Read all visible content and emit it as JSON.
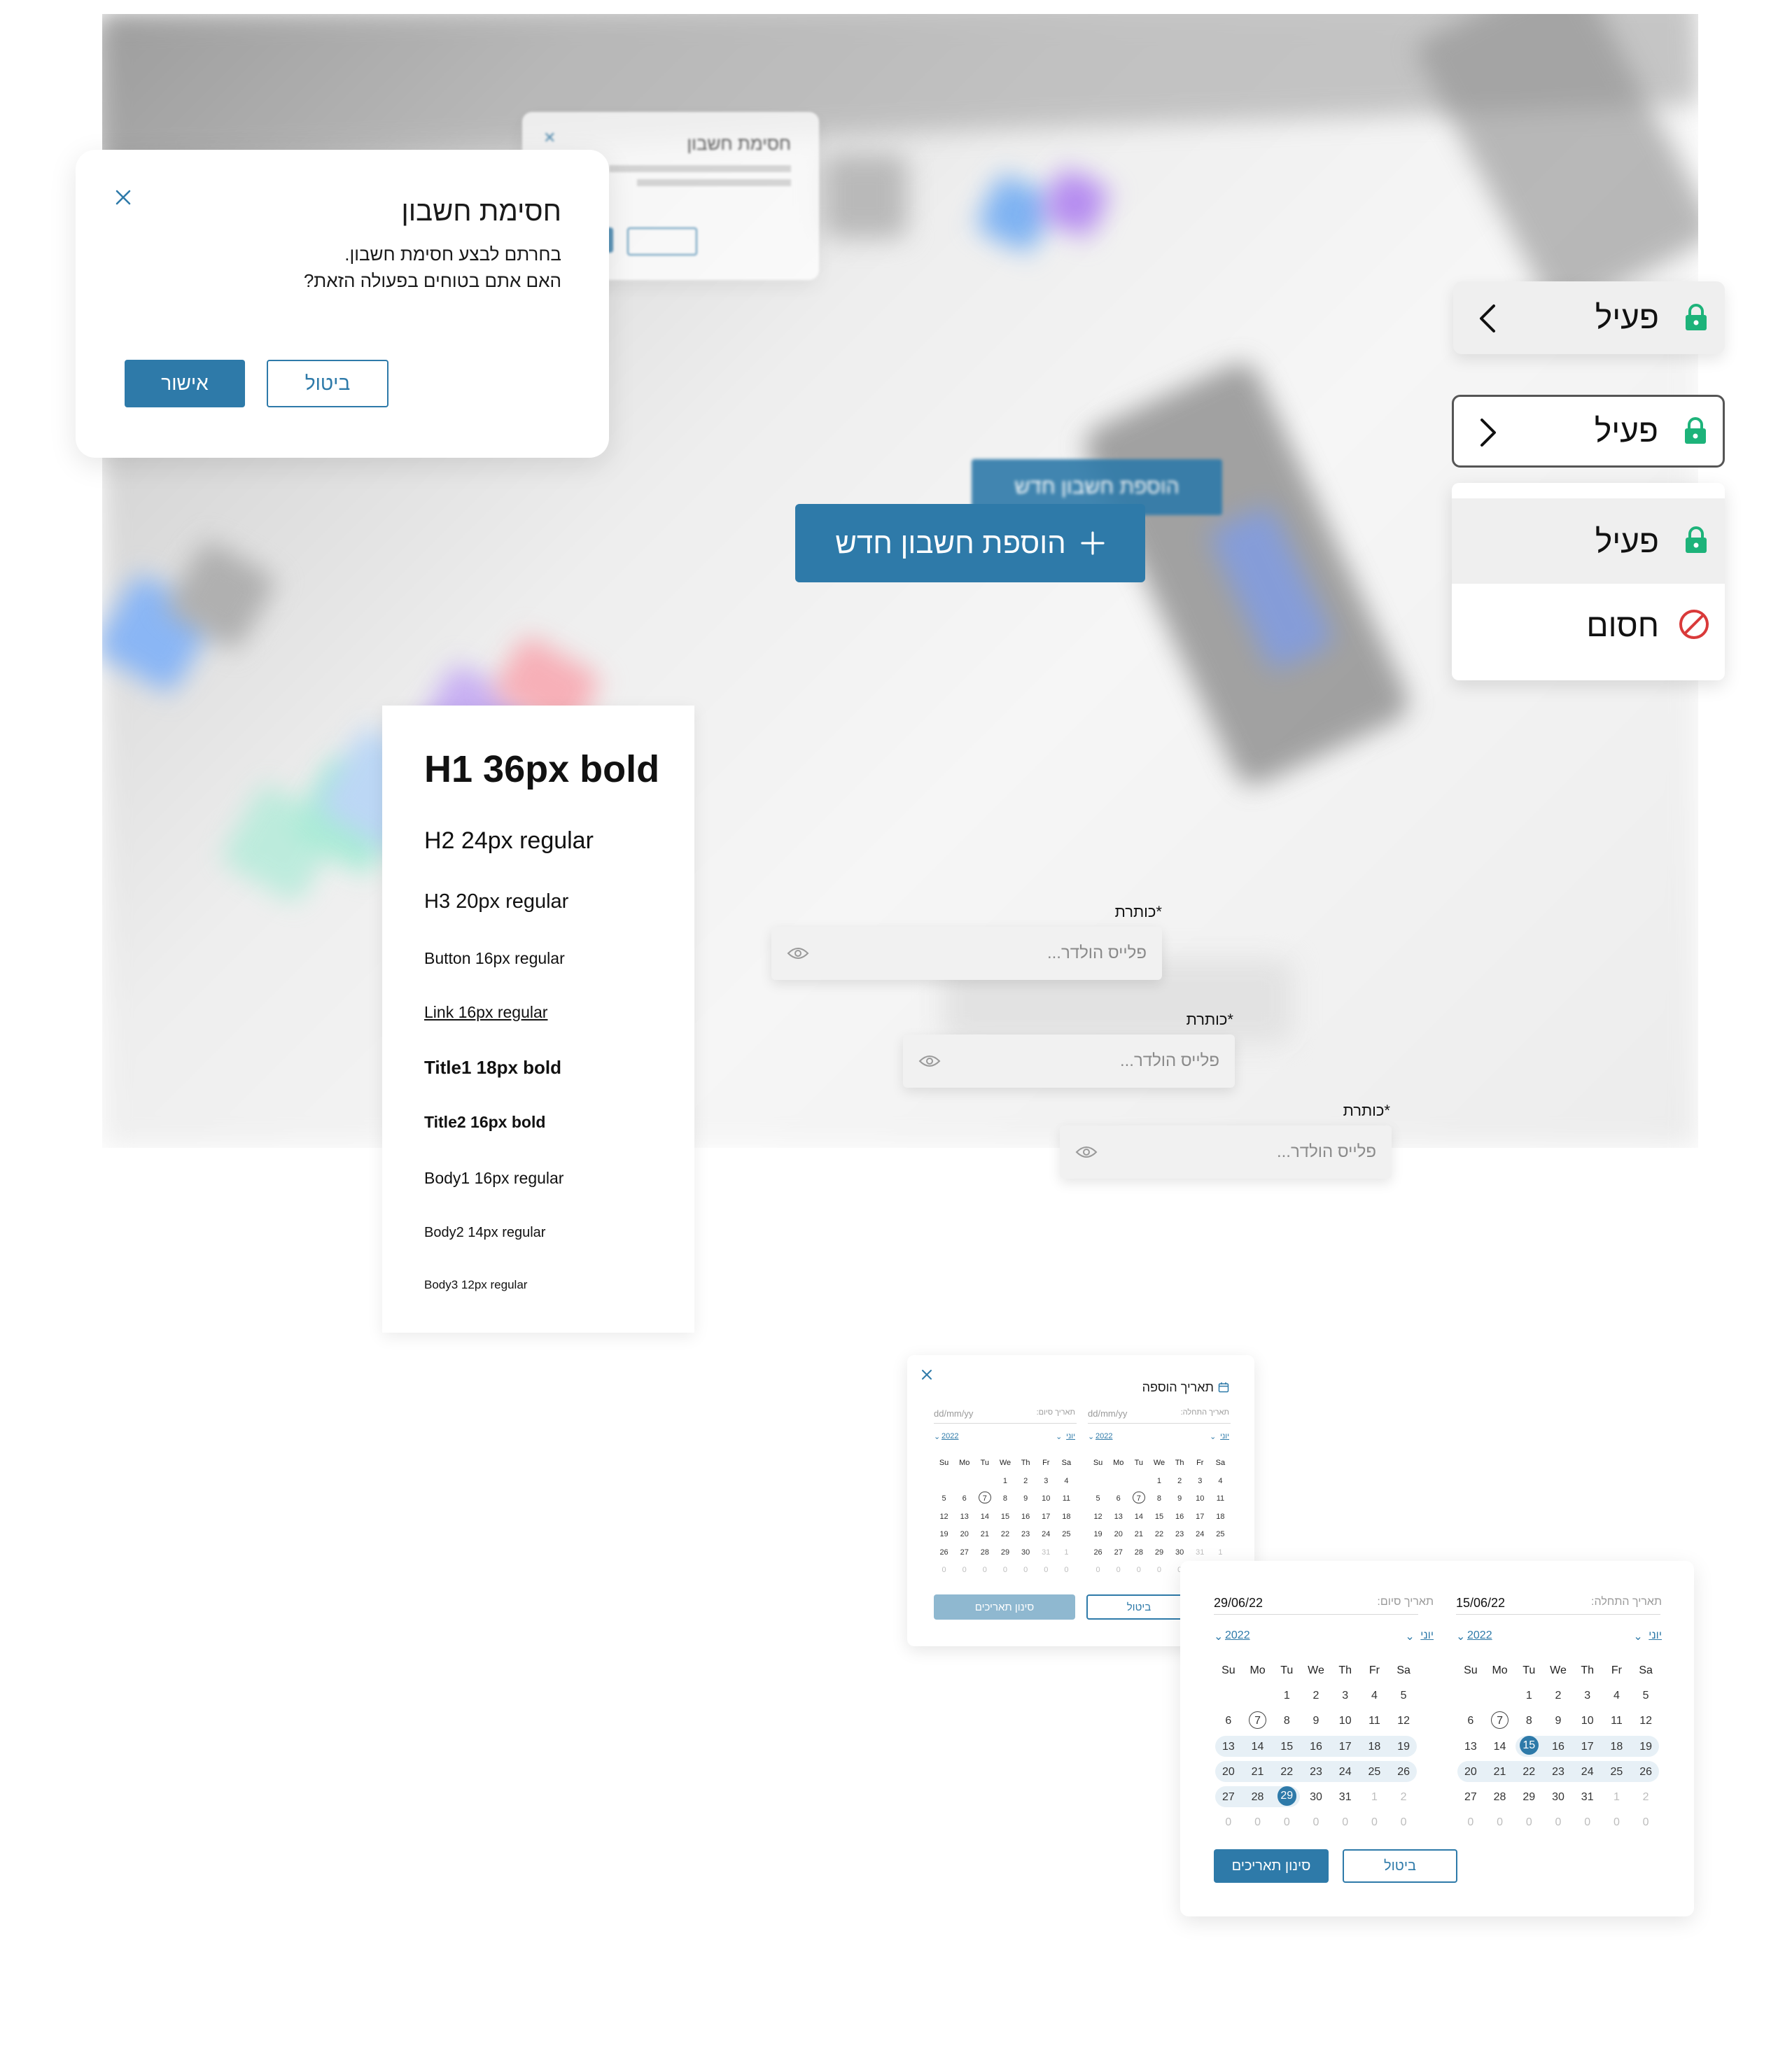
{
  "modal": {
    "title": "חסימת חשבון",
    "line1": "בחרתם לבצע חסימת חשבון.",
    "line2": "האם אתם בטוחים בפעולה הזאת?",
    "confirm": "אישור",
    "cancel": "ביטול"
  },
  "add_account_button": {
    "label": "הוספת חשבון חדש"
  },
  "status": {
    "active": "פעיל",
    "blocked": "חסום",
    "colors": {
      "active": "#1db37a",
      "blocked": "#d93a3a",
      "primary": "#2e7aa9"
    }
  },
  "typography": [
    "H1 36px bold",
    "H2 24px regular",
    "H3 20px regular",
    "Button 16px regular",
    "Link 16px regular",
    "Title1 18px bold",
    "Title2 16px bold",
    "Body1 16px regular",
    "Body2 14px regular",
    "Body3 12px regular"
  ],
  "inputs": [
    {
      "label": "*כותרת",
      "placeholder": "פלייס הולדר..."
    },
    {
      "label": "*כותרת",
      "placeholder": "פלייס הולדר..."
    },
    {
      "label": "*כותרת",
      "placeholder": "פלייס הולדר..."
    }
  ],
  "date_picker_small": {
    "title": "תאריך הוספה",
    "start_label": "תאריך התחלה:",
    "end_label": "תאריך סיום:",
    "start_value": "dd/mm/yy",
    "end_value": "dd/mm/yy",
    "filter": "סינון תאריכים",
    "cancel": "ביטול"
  },
  "date_picker_large": {
    "start_label": "תאריך התחלה:",
    "end_label": "תאריך סיום:",
    "start_value": "15/06/22",
    "end_value": "29/06/22",
    "filter": "סינון תאריכים",
    "cancel": "ביטול"
  },
  "calendar": {
    "month": "יוני",
    "year": "2022",
    "weekdays": [
      "Su",
      "Mo",
      "Tu",
      "We",
      "Th",
      "Fr",
      "Sa"
    ],
    "weeks": [
      [
        "",
        "",
        "1",
        "2",
        "3",
        "4",
        "5"
      ],
      [
        "6",
        "7",
        "8",
        "9",
        "10",
        "11",
        "12"
      ],
      [
        "13",
        "14",
        "15",
        "16",
        "17",
        "18",
        "19"
      ],
      [
        "20",
        "21",
        "22",
        "23",
        "24",
        "25",
        "26"
      ],
      [
        "27",
        "28",
        "29",
        "30",
        "31",
        "1",
        "2"
      ],
      [
        "0",
        "0",
        "0",
        "0",
        "0",
        "0",
        "0"
      ]
    ],
    "weeks_small": [
      [
        "",
        "",
        "",
        "1",
        "2",
        "3",
        "4"
      ],
      [
        "5",
        "6",
        "7",
        "8",
        "9",
        "10",
        "11"
      ],
      [
        "12",
        "13",
        "14",
        "15",
        "16",
        "17",
        "18"
      ],
      [
        "19",
        "20",
        "21",
        "22",
        "23",
        "24",
        "25"
      ],
      [
        "26",
        "27",
        "28",
        "29",
        "30",
        "31",
        "1",
        "2"
      ],
      [
        "0",
        "0",
        "0",
        "0",
        "0",
        "0",
        "0"
      ]
    ],
    "today": "7",
    "range_start": "15",
    "range_end": "29"
  }
}
